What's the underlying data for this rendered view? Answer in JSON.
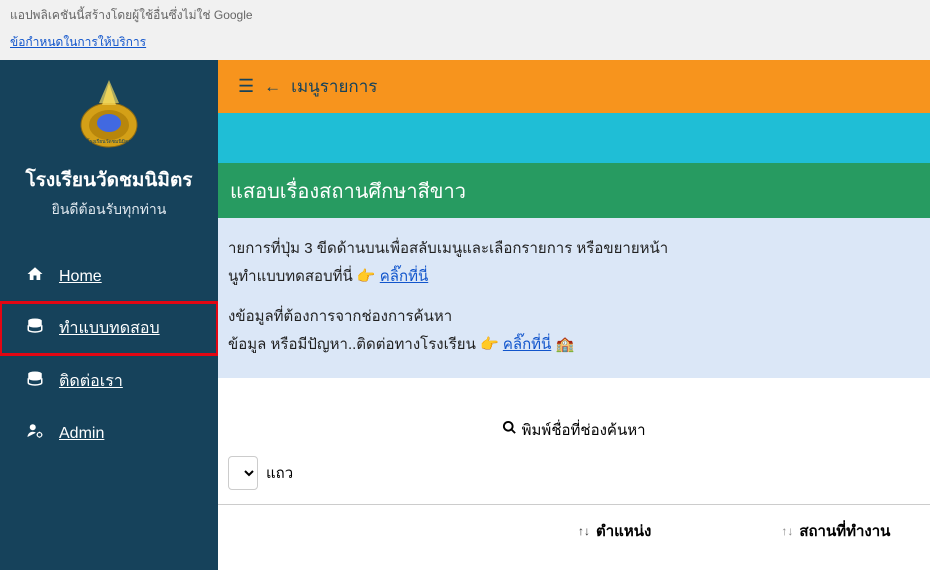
{
  "notice": {
    "text": "แอปพลิเคชันนี้สร้างโดยผู้ใช้อื่นซึ่งไม่ใช่ Google",
    "terms": "ข้อกำหนดในการให้บริการ"
  },
  "sidebar": {
    "title": "โรงเรียนวัดชมนิมิตร",
    "subtitle": "ยินดีต้อนรับทุกท่าน",
    "items": [
      {
        "label": "Home",
        "icon": "home"
      },
      {
        "label": "ทำแบบทดสอบ",
        "icon": "database"
      },
      {
        "label": "ติดต่อเรา",
        "icon": "database"
      },
      {
        "label": "Admin",
        "icon": "user-gear"
      }
    ]
  },
  "menubar": {
    "arrow": "←",
    "text": "เมนูรายการ"
  },
  "green_stripe": "แสอบเรื่องสถานศึกษาสีขาว",
  "info": {
    "line1": "ายการที่ปุ่ม 3 ขีดด้านบนเพื่อสลับเมนูและเลือกรายการ หรือขยายหน้า",
    "line2_prefix": "นูทำแบบทดสอบที่นี่ ",
    "line2_link": "คลิ๊กที่นี่",
    "line3": "งข้อมูลที่ต้องการจากช่องการค้นหา",
    "line4_prefix": "ข้อมูล หรือมีปัญหา..ติดต่อทางโรงเรียน ",
    "line4_link": "คลิ๊กที่นี่"
  },
  "search": {
    "placeholder": "พิมพ์ชื่อที่ช่องค้นหา"
  },
  "dropdown": {
    "label": "แถว"
  },
  "table": {
    "headers": {
      "position": "ตำแหน่ง",
      "workplace": "สถานที่ทำงาน"
    }
  }
}
